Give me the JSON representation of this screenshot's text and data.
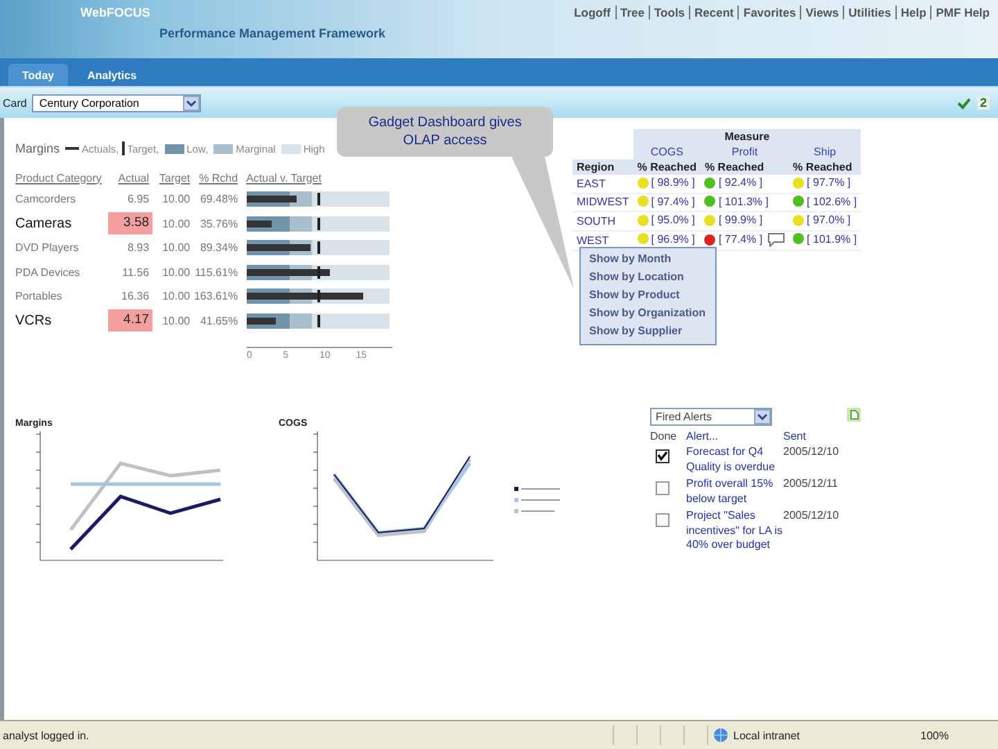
{
  "header": {
    "brand": "WebFOCUS",
    "subtitle": "Performance Management Framework",
    "links": [
      "Logoff",
      "Tree",
      "Tools",
      "Recent",
      "Favorites",
      "Views",
      "Utilities",
      "Help",
      "PMF Help"
    ]
  },
  "tabs": [
    {
      "label": "Today",
      "selected": true
    },
    {
      "label": "Analytics",
      "selected": false
    }
  ],
  "toolbar": {
    "label": "Card",
    "select": "Century Corporation",
    "count": "2"
  },
  "callout": {
    "text": "Gadget Dashboard gives OLAP access"
  },
  "margins": {
    "title": "Margins",
    "legend": [
      {
        "kind": "line",
        "label": "Actuals,",
        "color": "#333333"
      },
      {
        "kind": "tick",
        "label": "Target,",
        "color": "#333333"
      },
      {
        "kind": "swatch",
        "label": "Low,",
        "color": "#6f93a8"
      },
      {
        "kind": "swatch",
        "label": "Marginal",
        "color": "#a9c0cc"
      },
      {
        "kind": "swatch",
        "label": "High",
        "color": "#d8e2e8"
      }
    ],
    "columns": [
      "Product Category",
      "Actual",
      "Target",
      "% Rchd",
      "Actual v. Target"
    ],
    "rows": [
      {
        "product": "Camcorders",
        "actual": "6.95",
        "target": "10.00",
        "pct": "69.48%",
        "below_target": false,
        "level": 0.35
      },
      {
        "product": "Cameras",
        "actual": "3.58",
        "target": "10.00",
        "pct": "35.76%",
        "below_target": true,
        "level": 0.18
      },
      {
        "product": "DVD Players",
        "actual": "8.93",
        "target": "10.00",
        "pct": "89.34%",
        "below_target": false,
        "level": 0.45
      },
      {
        "product": "PDA Devices",
        "actual": "11.56",
        "target": "10.00",
        "pct": "115.61%",
        "below_target": false,
        "level": 0.58
      },
      {
        "product": "Portables",
        "actual": "16.36",
        "target": "10.00",
        "pct": "163.61%",
        "below_target": false,
        "level": 0.82
      },
      {
        "product": "VCRs",
        "actual": "4.17",
        "target": "10.00",
        "pct": "41.65%",
        "below_target": true,
        "level": 0.21
      }
    ],
    "axis_ticks": [
      "0",
      "5",
      "10",
      "15"
    ]
  },
  "olap": {
    "title": "Measure",
    "measures": [
      {
        "name": "COGS",
        "sub_label": "% Reached"
      },
      {
        "name": "Profit",
        "sub_label": "% Reached"
      },
      {
        "name": "Ship",
        "sub_label": "% Reached"
      }
    ],
    "region_label": "Region",
    "rows": [
      {
        "region": "EAST",
        "cells": [
          {
            "value": "[ 98.9% ]",
            "color": "#e8e020"
          },
          {
            "value": "[ 92.4% ]",
            "color": "#4fbf22"
          },
          {
            "value": "[ 97.7% ]",
            "color": "#e8e020"
          }
        ]
      },
      {
        "region": "MIDWEST",
        "cells": [
          {
            "value": "[ 97.4% ]",
            "color": "#e8e020"
          },
          {
            "value": "[ 101.3% ]",
            "color": "#4fbf22"
          },
          {
            "value": "[ 102.6% ]",
            "color": "#4fbf22"
          }
        ]
      },
      {
        "region": "SOUTH",
        "cells": [
          {
            "value": "[ 95.0% ]",
            "color": "#e8e020"
          },
          {
            "value": "[ 99.9% ]",
            "color": "#e8e020"
          },
          {
            "value": "[ 97.0% ]",
            "color": "#e8e020"
          }
        ]
      },
      {
        "region": "WEST",
        "cells": [
          {
            "value": "[ 96.9% ]",
            "color": "#e8e020"
          },
          {
            "value": "[ 77.4% ]",
            "color": "#e02222",
            "note": true
          },
          {
            "value": "[ 101.9% ]",
            "color": "#4fbf22"
          }
        ]
      }
    ],
    "menu": [
      "Show by Month",
      "Show by Location",
      "Show by Product",
      "Show by Organization",
      "Show by Supplier"
    ]
  },
  "charts": [
    {
      "title": "Margins"
    },
    {
      "title": "COGS"
    }
  ],
  "alerts": {
    "filter": "Fired Alerts",
    "columns": [
      "Done",
      "Alert...",
      "Sent"
    ],
    "rows": [
      {
        "checked": true,
        "text": "Forecast for Q4 Quality is overdue",
        "sent": "2005/12/10"
      },
      {
        "checked": false,
        "text": "Profit overall 15% below target",
        "sent": "2005/12/11"
      },
      {
        "checked": false,
        "text": "Project \"Sales incentives\" for LA is 40% over budget",
        "sent": "2005/12/10"
      }
    ]
  },
  "status_bar": {
    "text": "analyst logged in.",
    "zone": "Local intranet",
    "zoom": "100%"
  }
}
